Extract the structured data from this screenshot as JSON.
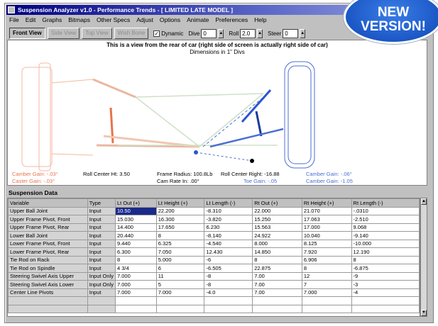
{
  "window": {
    "title": "Suspension Analyzer v1.0 - Performance Trends - [ LIMITED LATE MODEL ]"
  },
  "menu": [
    "File",
    "Edit",
    "Graphs",
    "Bitmaps",
    "Other Specs",
    "Adjust",
    "Options",
    "Animate",
    "Preferences",
    "Help"
  ],
  "toolbar": {
    "buttons": [
      "Front View",
      "Side View",
      "Top View",
      "Wish Bone"
    ],
    "dynamic_label": "Dynamic",
    "dive_label": "Dive",
    "dive_value": "0",
    "roll_label": "Roll",
    "roll_value": "2.0",
    "steer_label": "Steer",
    "steer_value": "0"
  },
  "view": {
    "caption": "This is a view from the rear of car (right side of screen is actually right side of car)",
    "subcaption": "Dimensions in 1\" Divs",
    "labels": {
      "left_camber_gain": "Camber Gain: -.03°",
      "left_caster_gain": "Caster Gain: -.03°",
      "roll_center_ht": "Roll Center Ht: 3.50",
      "frame_radius": "Frame Radius: 100.8Lb",
      "cam_rate": "Cam Rate In: .00°",
      "roll_center_right": "Roll Center Right: -16.88",
      "right_camber_gain": "Camber Gain: -.06°",
      "right_caster_gain": "Camber Gain: -1.05",
      "toe_gain": "Toe Gain: -.05"
    }
  },
  "data": {
    "title": "Suspension Data",
    "columns": [
      "Variable",
      "Type",
      "Lt Out (+)",
      "Lt Height (+)",
      "Lt Length (-)",
      "Rt Out (+)",
      "Rt Height (+)",
      "Rt Length (-)"
    ],
    "rows": [
      [
        "Upper Ball Joint",
        "Input",
        "10.50",
        "22.200",
        "-8.310",
        "22.000",
        "21.070",
        "-.0310"
      ],
      [
        "Upper Frame Pivot, Front",
        "Input",
        "15.030",
        "16.300",
        "-3.820",
        "15.250",
        "17.063",
        "-2.510"
      ],
      [
        "Upper Frame Pivot, Rear",
        "Input",
        "14.400",
        "17.650",
        "6.230",
        "15.563",
        "17.000",
        "9.068"
      ],
      [
        "Lower Ball Joint",
        "Input",
        "20.440",
        "8",
        "-8.140",
        "24.922",
        "10.040",
        "-9.140"
      ],
      [
        "Lower Frame Pivot, Front",
        "Input",
        "9.440",
        "6.325",
        "-4.540",
        "8.000",
        "8.125",
        "-10.000"
      ],
      [
        "Lower Frame Pivot, Rear",
        "Input",
        "6.300",
        "7.050",
        "12.430",
        "14.850",
        "7.920",
        "12.190"
      ],
      [
        "Tie Rod on Rack",
        "Input",
        "8",
        "5.000",
        "-6",
        "8",
        "6.906",
        "8"
      ],
      [
        "Tie Rod on Spindle",
        "Input",
        "4 3/4",
        "6",
        "-6.505",
        "22.875",
        "8",
        "-6.875"
      ],
      [
        "Steering Swivel Axis Upper",
        "Input Only",
        "7.000",
        "11",
        "-8",
        "7.00",
        "12",
        "-9"
      ],
      [
        "Steering Swivel Axis Lower",
        "Input Only",
        "7.000",
        "5",
        "-8",
        "7.00",
        "7",
        "-3"
      ],
      [
        "Center Line Pivots",
        "Input",
        "7.000",
        "7.000",
        "-4.0",
        "7.00",
        "7.000",
        "-4"
      ],
      [
        "",
        "",
        "",
        "",
        "",
        "",
        "",
        ""
      ],
      [
        "",
        "",
        "",
        "",
        "",
        "",
        "",
        ""
      ]
    ]
  },
  "badge": {
    "line1": "NEW",
    "line2": "VERSION!"
  }
}
